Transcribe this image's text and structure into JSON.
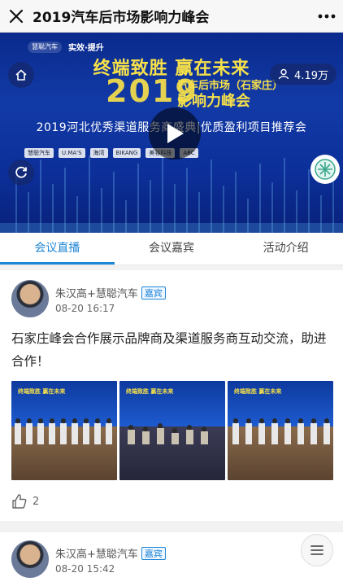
{
  "topbar": {
    "title": "2019汽车后市场影响力峰会"
  },
  "banner": {
    "logos": [
      "慧聪汽车",
      "实效·提升"
    ],
    "slogan": "终端致胜 赢在未来",
    "year": "2019",
    "subtitle1": "汽车后市场（石家庄）",
    "subtitle2": "影响力峰会",
    "event_line": "2019河北优秀渠道服务商盛典|优质盈利项目推荐会",
    "sponsors": [
      "慧聪汽车",
      "U.MA'S",
      "海湾",
      "BIKANG",
      "美谷科技",
      "ABC"
    ],
    "views": "4.19万"
  },
  "tabs": [
    {
      "label": "会议直播",
      "active": true
    },
    {
      "label": "会议嘉宾",
      "active": false
    },
    {
      "label": "活动介绍",
      "active": false
    }
  ],
  "posts": [
    {
      "author": "朱汉高+慧聪汽车",
      "badge": "嘉宾",
      "time": "08-20 16:17",
      "text": "石家庄峰会合作展示品牌商及渠道服务商互动交流，助进合作！",
      "photo_captions": [
        "终端致胜 赢在未来",
        "终端致胜 赢在未来",
        "终端致胜 赢在未来"
      ],
      "likes": "2"
    },
    {
      "author": "朱汉高+慧聪汽车",
      "badge": "嘉宾",
      "time": "08-20 15:42"
    }
  ],
  "colors": {
    "accent": "#1f86d6",
    "banner_blue": "#0c2f99",
    "title_yellow": "#f6e04a"
  },
  "icons": {
    "close": "close-icon",
    "more": "more-icon",
    "home": "home-icon",
    "refresh": "refresh-icon",
    "views": "person-icon",
    "play": "play-icon",
    "like": "thumbs-up-icon",
    "menu": "menu-icon"
  }
}
